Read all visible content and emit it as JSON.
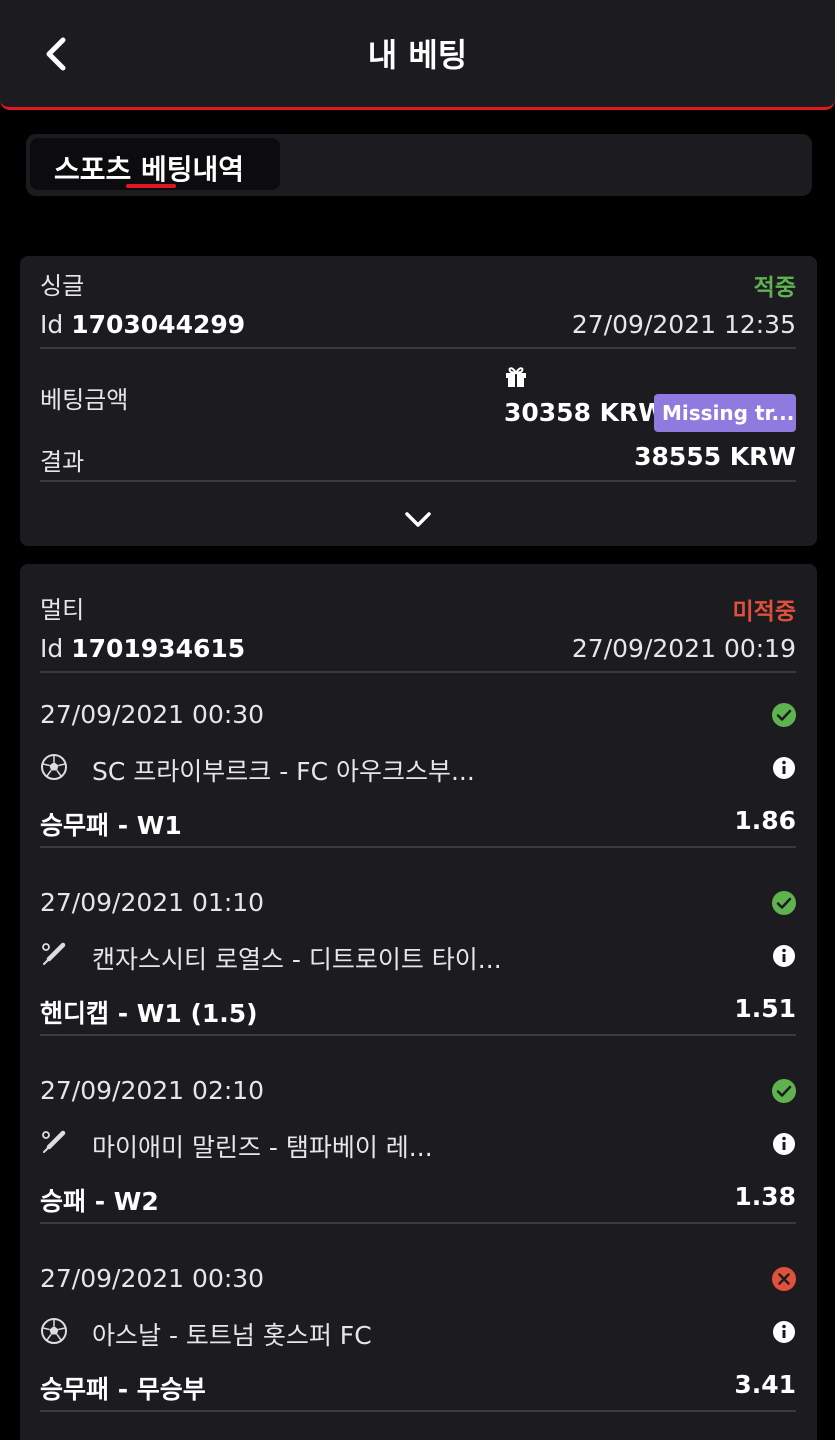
{
  "header": {
    "title": "내 베팅"
  },
  "tabs": [
    {
      "label": "스포츠 베팅내역"
    }
  ],
  "bets": [
    {
      "type": "싱글",
      "status": "적중",
      "id_label": "Id",
      "id_value": "1703044299",
      "datetime": "27/09/2021 12:35",
      "stake_label": "베팅금액",
      "stake_value": "30358 KRW",
      "badge": "Missing tr...",
      "result_label": "결과",
      "result_value": "38555 KRW"
    },
    {
      "type": "멀티",
      "status": "미적중",
      "id_label": "Id",
      "id_value": "1701934615",
      "datetime": "27/09/2021 00:19",
      "selections": [
        {
          "datetime": "27/09/2021 00:30",
          "sport_icon": "soccer-ball-icon",
          "match": "SC 프라이부르크 - FC 아우크스부...",
          "market": "승무패 - W1",
          "odds": "1.86",
          "status_icon": "check-circle-icon"
        },
        {
          "datetime": "27/09/2021 01:10",
          "sport_icon": "baseball-bat-icon",
          "match": "캔자스시티 로열스 - 디트로이트 타이...",
          "market": "핸디캡 - W1 (1.5)",
          "odds": "1.51",
          "status_icon": "check-circle-icon"
        },
        {
          "datetime": "27/09/2021 02:10",
          "sport_icon": "baseball-bat-icon",
          "match": "마이애미 말린즈 - 탬파베이 레...",
          "market": "승패 - W2",
          "odds": "1.38",
          "status_icon": "check-circle-icon"
        },
        {
          "datetime": "27/09/2021 00:30",
          "sport_icon": "soccer-ball-icon",
          "match": "아스날 - 토트넘 홋스퍼 FC",
          "market": "승무패 - 무승부",
          "odds": "3.41",
          "status_icon": "cross-circle-icon"
        }
      ]
    }
  ],
  "colors": {
    "accent": "#e01620",
    "won": "#5fb34f",
    "lost": "#e1503a",
    "badge": "#8f7be0",
    "card": "#1c1c20"
  }
}
